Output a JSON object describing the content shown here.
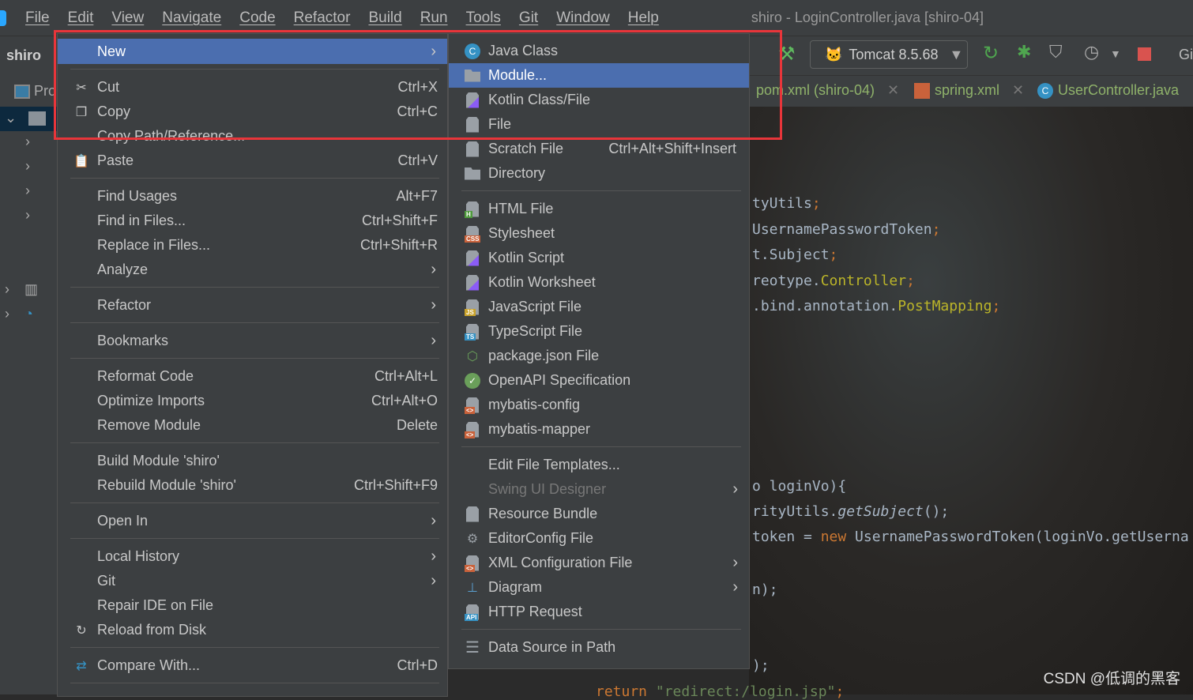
{
  "menubar": {
    "items": [
      "File",
      "Edit",
      "View",
      "Navigate",
      "Code",
      "Refactor",
      "Build",
      "Run",
      "Tools",
      "Git",
      "Window",
      "Help"
    ],
    "title": "shiro - LoginController.java [shiro-04]"
  },
  "toolbar": {
    "project": "shiro",
    "run_config": "Tomcat 8.5.68",
    "git_label": "Gi"
  },
  "tabs": [
    {
      "label": "pom.xml (shiro-04)"
    },
    {
      "label": "spring.xml"
    },
    {
      "label": "UserController.java"
    }
  ],
  "sidebar": {
    "project_tab": "Pro"
  },
  "context_menu": [
    {
      "label": "New",
      "arrow": true,
      "selected": true
    },
    {
      "sep": true
    },
    {
      "label": "Cut",
      "shortcut": "Ctrl+X",
      "icon": "scissors-icon"
    },
    {
      "label": "Copy",
      "shortcut": "Ctrl+C",
      "icon": "copy-icon"
    },
    {
      "label": "Copy Path/Reference..."
    },
    {
      "label": "Paste",
      "shortcut": "Ctrl+V",
      "icon": "clipboard-icon"
    },
    {
      "sep": true
    },
    {
      "label": "Find Usages",
      "shortcut": "Alt+F7"
    },
    {
      "label": "Find in Files...",
      "shortcut": "Ctrl+Shift+F"
    },
    {
      "label": "Replace in Files...",
      "shortcut": "Ctrl+Shift+R"
    },
    {
      "label": "Analyze",
      "arrow": true
    },
    {
      "sep": true
    },
    {
      "label": "Refactor",
      "arrow": true
    },
    {
      "sep": true
    },
    {
      "label": "Bookmarks",
      "arrow": true
    },
    {
      "sep": true
    },
    {
      "label": "Reformat Code",
      "shortcut": "Ctrl+Alt+L"
    },
    {
      "label": "Optimize Imports",
      "shortcut": "Ctrl+Alt+O"
    },
    {
      "label": "Remove Module",
      "shortcut": "Delete"
    },
    {
      "sep": true
    },
    {
      "label": "Build Module 'shiro'"
    },
    {
      "label": "Rebuild Module 'shiro'",
      "shortcut": "Ctrl+Shift+F9"
    },
    {
      "sep": true
    },
    {
      "label": "Open In",
      "arrow": true
    },
    {
      "sep": true
    },
    {
      "label": "Local History",
      "arrow": true
    },
    {
      "label": "Git",
      "arrow": true
    },
    {
      "label": "Repair IDE on File"
    },
    {
      "label": "Reload from Disk",
      "icon": "reload-icon"
    },
    {
      "sep": true
    },
    {
      "label": "Compare With...",
      "shortcut": "Ctrl+D",
      "icon": "compare-icon"
    },
    {
      "sep": true
    }
  ],
  "new_submenu": [
    {
      "label": "Java Class",
      "icon": "java-class-icon"
    },
    {
      "label": "Module...",
      "icon": "module-folder-icon",
      "selected": true
    },
    {
      "label": "Kotlin Class/File",
      "icon": "kotlin-file-icon"
    },
    {
      "label": "File",
      "icon": "file-icon"
    },
    {
      "label": "Scratch File",
      "shortcut": "Ctrl+Alt+Shift+Insert",
      "icon": "scratch-file-icon"
    },
    {
      "label": "Directory",
      "icon": "folder-icon"
    },
    {
      "sep": true
    },
    {
      "label": "HTML File",
      "icon": "html-file-icon",
      "badge": "H"
    },
    {
      "label": "Stylesheet",
      "icon": "css-file-icon",
      "badge": "CSS"
    },
    {
      "label": "Kotlin Script",
      "icon": "kotlin-script-icon"
    },
    {
      "label": "Kotlin Worksheet",
      "icon": "kotlin-worksheet-icon"
    },
    {
      "label": "JavaScript File",
      "icon": "js-file-icon",
      "badge": "JS"
    },
    {
      "label": "TypeScript File",
      "icon": "ts-file-icon",
      "badge": "TS"
    },
    {
      "label": "package.json File",
      "icon": "nodejs-icon"
    },
    {
      "label": "OpenAPI Specification",
      "icon": "openapi-icon"
    },
    {
      "label": "mybatis-config",
      "icon": "xml-file-icon",
      "badge": "<>"
    },
    {
      "label": "mybatis-mapper",
      "icon": "xml-file-icon",
      "badge": "<>"
    },
    {
      "sep": true
    },
    {
      "label": "Edit File Templates..."
    },
    {
      "label": "Swing UI Designer",
      "arrow": true,
      "disabled": true
    },
    {
      "label": "Resource Bundle",
      "icon": "resource-bundle-icon"
    },
    {
      "label": "EditorConfig File",
      "icon": "gear-icon"
    },
    {
      "label": "XML Configuration File",
      "icon": "xml-file-icon",
      "badge": "<>",
      "arrow": true
    },
    {
      "label": "Diagram",
      "icon": "diagram-icon",
      "arrow": true
    },
    {
      "label": "HTTP Request",
      "icon": "http-request-icon",
      "badge": "API"
    },
    {
      "sep": true
    },
    {
      "label": "Data Source in Path",
      "icon": "database-icon"
    }
  ],
  "code_lines": [
    [
      "tyUtils",
      ";"
    ],
    [
      "UsernamePasswordToken",
      ";"
    ],
    [
      "t.Subject",
      ";"
    ],
    [
      "reotype.",
      "Controller",
      ";"
    ],
    [
      ".bind.annotation.",
      "PostMapping",
      ";"
    ],
    [
      "o loginVo){"
    ],
    [
      "rityUtils.",
      "getSubject",
      "();"
    ],
    [
      "token = ",
      "new",
      " UsernamePasswordToken(loginVo.getUserna"
    ],
    [
      "n);"
    ],
    [
      ");"
    ],
    [
      "return",
      " \"redirect:/login.jsp\"",
      ";"
    ]
  ],
  "watermark": "CSDN @低调的黑客",
  "colors": {
    "selection": "#4b6eaf",
    "highlight_box": "#e8353a",
    "menu_bg": "#3c3f41"
  }
}
